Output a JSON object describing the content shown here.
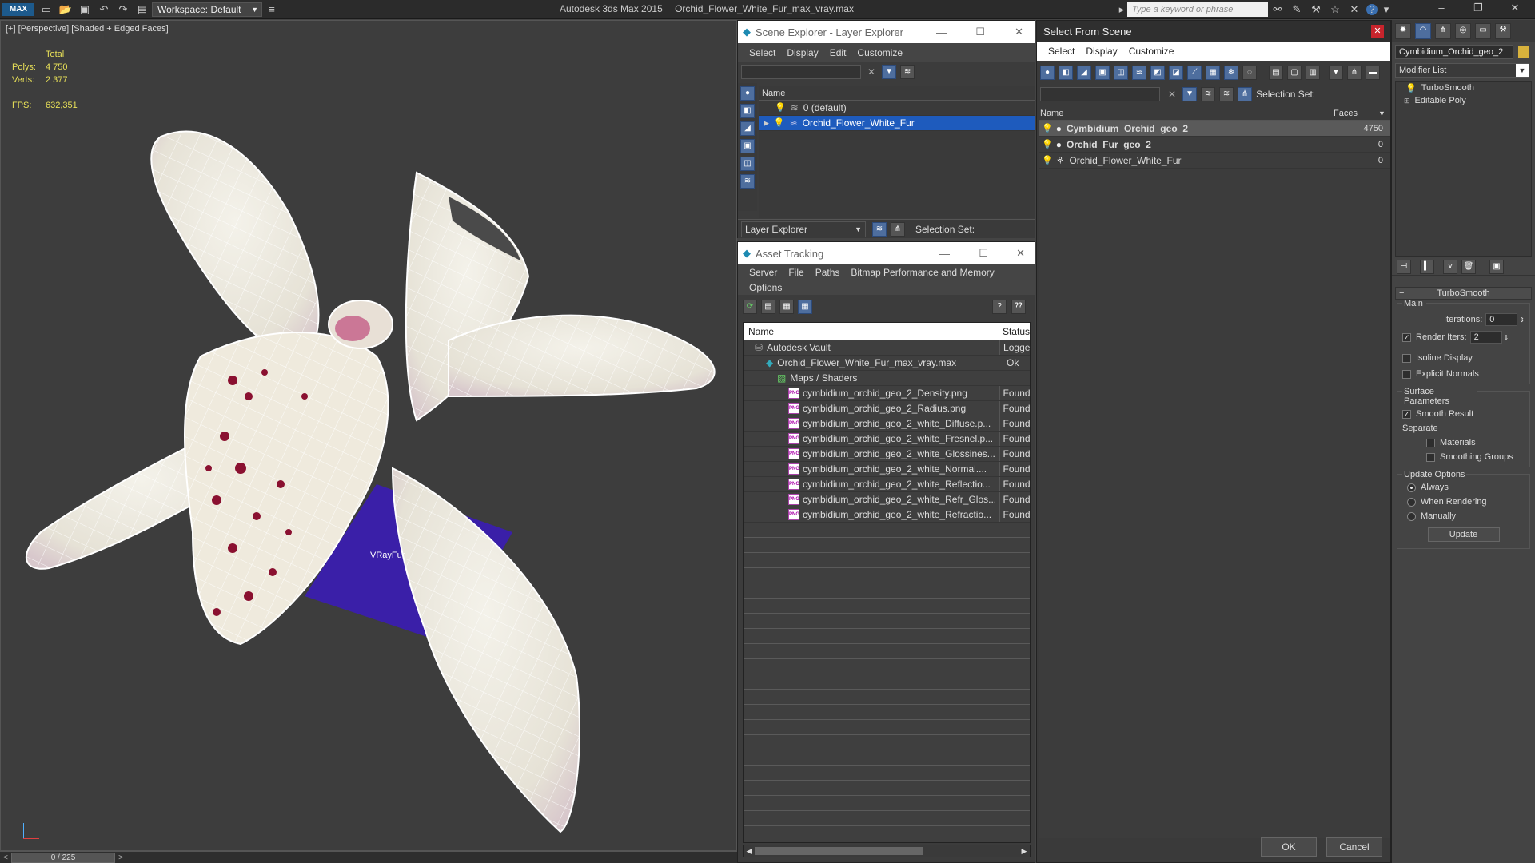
{
  "titlebar": {
    "app_logo": "MAX",
    "workspace": "Workspace: Default",
    "app_title": "Autodesk 3ds Max  2015",
    "file_title": "Orchid_Flower_White_Fur_max_vray.max",
    "search_placeholder": "Type a keyword or phrase"
  },
  "viewport": {
    "label": "[+] [Perspective] [Shaded + Edged Faces]",
    "stats": {
      "total_label": "Total",
      "polys_label": "Polys:",
      "polys": "4 750",
      "verts_label": "Verts:",
      "verts": "2 377",
      "fps_label": "FPS:",
      "fps": "632,351"
    },
    "object_label": "VRayFur",
    "timeline": "0 / 225",
    "colors": {
      "background": "#3d3d3d",
      "petal": "#ece9df",
      "spots": "#8a1030",
      "fur_plane": "#3a1fa8",
      "wire": "#ffffff"
    }
  },
  "scene_explorer": {
    "title": "Scene Explorer - Layer Explorer",
    "menu": [
      "Select",
      "Display",
      "Edit",
      "Customize"
    ],
    "col_name": "Name",
    "rows": [
      {
        "label": "0 (default)",
        "selected": false
      },
      {
        "label": "Orchid_Flower_White_Fur",
        "selected": true
      }
    ],
    "footer_dropdown": "Layer Explorer",
    "selection_set_label": "Selection Set:"
  },
  "asset_tracking": {
    "title": "Asset Tracking",
    "menu": [
      "Server",
      "File",
      "Paths",
      "Bitmap Performance and Memory"
    ],
    "menu2": [
      "Options"
    ],
    "col_name": "Name",
    "col_status": "Status",
    "rows": [
      {
        "name": "Autodesk Vault",
        "status": "Logge",
        "indent": 0,
        "icon": "vault"
      },
      {
        "name": "Orchid_Flower_White_Fur_max_vray.max",
        "status": "Ok",
        "indent": 1,
        "icon": "max"
      },
      {
        "name": "Maps / Shaders",
        "status": "",
        "indent": 2,
        "icon": "maps"
      },
      {
        "name": "cymbidium_orchid_geo_2_Density.png",
        "status": "Found",
        "indent": 3,
        "icon": "png"
      },
      {
        "name": "cymbidium_orchid_geo_2_Radius.png",
        "status": "Found",
        "indent": 3,
        "icon": "png"
      },
      {
        "name": "cymbidium_orchid_geo_2_white_Diffuse.p...",
        "status": "Found",
        "indent": 3,
        "icon": "png"
      },
      {
        "name": "cymbidium_orchid_geo_2_white_Fresnel.p...",
        "status": "Found",
        "indent": 3,
        "icon": "png"
      },
      {
        "name": "cymbidium_orchid_geo_2_white_Glossines...",
        "status": "Found",
        "indent": 3,
        "icon": "png"
      },
      {
        "name": "cymbidium_orchid_geo_2_white_Normal....",
        "status": "Found",
        "indent": 3,
        "icon": "png"
      },
      {
        "name": "cymbidium_orchid_geo_2_white_Reflectio...",
        "status": "Found",
        "indent": 3,
        "icon": "png"
      },
      {
        "name": "cymbidium_orchid_geo_2_white_Refr_Glos...",
        "status": "Found",
        "indent": 3,
        "icon": "png"
      },
      {
        "name": "cymbidium_orchid_geo_2_white_Refractio...",
        "status": "Found",
        "indent": 3,
        "icon": "png"
      }
    ],
    "png_badge": "PNG"
  },
  "select_from_scene": {
    "title": "Select From Scene",
    "menu": [
      "Select",
      "Display",
      "Customize"
    ],
    "selection_set_label": "Selection Set:",
    "col_name": "Name",
    "col_faces": "Faces",
    "rows": [
      {
        "name": "Cymbidium_Orchid_geo_2",
        "faces": "4750",
        "bold": true,
        "highlight": true
      },
      {
        "name": "Orchid_Fur_geo_2",
        "faces": "0",
        "bold": true,
        "highlight": false
      },
      {
        "name": "Orchid_Flower_White_Fur",
        "faces": "0",
        "bold": false,
        "highlight": false
      }
    ],
    "ok": "OK",
    "cancel": "Cancel"
  },
  "command_panel": {
    "object_name": "Cymbidium_Orchid_geo_2",
    "modifier_list": "Modifier List",
    "stack": [
      "TurboSmooth",
      "Editable Poly"
    ],
    "rollout_title": "TurboSmooth",
    "main_label": "Main",
    "iterations_label": "Iterations:",
    "iterations": "0",
    "render_iters_label": "Render Iters:",
    "render_iters": "2",
    "isoline_label": "Isoline Display",
    "explicit_label": "Explicit Normals",
    "surface_label": "Surface Parameters",
    "smooth_label": "Smooth Result",
    "separate_label": "Separate",
    "materials_label": "Materials",
    "smoothing_label": "Smoothing Groups",
    "update_options_label": "Update Options",
    "always_label": "Always",
    "when_rendering_label": "When Rendering",
    "manually_label": "Manually",
    "update_button": "Update",
    "colors": {
      "accent": "#1e5bbd",
      "color_swatch": "#d8b23c"
    }
  }
}
